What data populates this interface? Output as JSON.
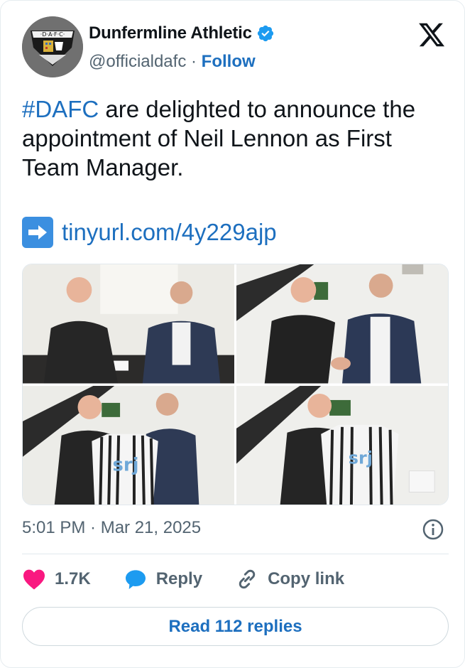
{
  "account": {
    "name": "Dunfermline Athletic",
    "handle": "@officialdafc",
    "separator": "·",
    "follow_label": "Follow",
    "avatar_text": "·D·A·F·C·"
  },
  "tweet": {
    "hashtag": "#DAFC",
    "text": " are delighted to announce the appointment of Neil Lennon as First Team Manager.",
    "link": "tinyurl.com/4y229ajp"
  },
  "media": {
    "photos": [
      "signing-photo",
      "handshake-photo",
      "shirt-presentation-photo-1",
      "shirt-presentation-photo-2"
    ],
    "shirt_text": "srj"
  },
  "meta": {
    "timestamp": "5:01 PM · Mar 21, 2025"
  },
  "actions": {
    "likes": "1.7K",
    "reply_label": "Reply",
    "copy_label": "Copy link"
  },
  "read_replies": "Read 112 replies",
  "colors": {
    "accent": "#1d6fbf",
    "verified": "#1d9bf0",
    "like": "#f91880",
    "muted": "#536471"
  },
  "icons": [
    "verified-badge-icon",
    "x-logo-icon",
    "right-arrow-emoji-icon",
    "info-icon",
    "heart-icon",
    "reply-bubble-icon",
    "link-icon"
  ]
}
